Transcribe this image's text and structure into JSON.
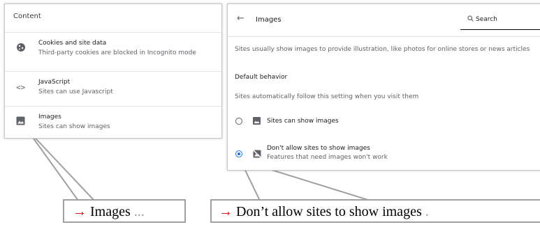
{
  "settings_list": {
    "title": "Content",
    "items": [
      {
        "icon": "cookie-icon",
        "title": "Cookies and site data",
        "subtitle": "Third-party cookies are blocked in Incognito mode"
      },
      {
        "icon": "code-icon",
        "title": "JavaScript",
        "subtitle": "Sites can use Javascript"
      },
      {
        "icon": "image-icon",
        "title": "Images",
        "subtitle": "Sites can show images"
      }
    ]
  },
  "images_page": {
    "back_icon": "arrow-left-icon",
    "title": "Images",
    "search_icon": "search-icon",
    "search_label": "Search",
    "description": "Sites usually show images to provide illustration, like photos for online stores or news articles",
    "default_heading": "Default behavior",
    "default_subtext": "Sites automatically follow this setting when you visit them",
    "options": [
      {
        "icon": "image-icon",
        "label": "Sites can show images",
        "sublabel": "",
        "selected": false
      },
      {
        "icon": "image-off-icon",
        "label": "Don't allow sites to show images",
        "sublabel": "Features that need images won't work",
        "selected": true
      }
    ]
  },
  "callouts": {
    "arrow": "→",
    "left_label": " Images",
    "left_suffix": " ...",
    "right_label": " Don’t allow sites to show images",
    "right_suffix": " ."
  },
  "colors": {
    "accent": "#1a73e8",
    "arrow": "#e00000",
    "callout_border": "#a0a0a0"
  }
}
